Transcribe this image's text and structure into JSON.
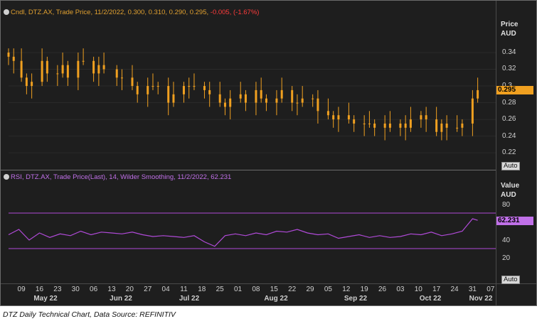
{
  "header_price": {
    "prefix": "Cndl, DTZ.AX, Trade Price, 11/2/2022, 0.300, 0.310, 0.290, 0.295, ",
    "change": "-0.005, (-1.67%)"
  },
  "header_rsi": "RSI, DTZ.AX, Trade Price(Last), 14, Wilder Smoothing, 11/2/2022, 62.231",
  "price_axis": {
    "title1": "Price",
    "title2": "AUD",
    "ticks": [
      "0.34",
      "0.32",
      "0.3",
      "0.28",
      "0.26",
      "0.24",
      "0.22"
    ],
    "last_tag": "0.295",
    "auto": "Auto"
  },
  "rsi_axis": {
    "title1": "Value",
    "title2": "AUD",
    "ticks": [
      "80",
      "60",
      "40",
      "20"
    ],
    "last_tag": "62.231",
    "auto": "Auto"
  },
  "x_ticks": [
    "09",
    "16",
    "23",
    "30",
    "06",
    "13",
    "20",
    "27",
    "04",
    "11",
    "18",
    "25",
    "01",
    "08",
    "15",
    "22",
    "29",
    "05",
    "12",
    "19",
    "26",
    "03",
    "10",
    "17",
    "24",
    "31",
    "07"
  ],
  "months": [
    "May 22",
    "Jun 22",
    "Jul 22",
    "Aug 22",
    "Sep 22",
    "Oct 22",
    "Nov 22"
  ],
  "caption": "DTZ Daily Technical Chart, Data Source: REFINITIV",
  "colors": {
    "candle": "#f0a020",
    "rsi": "#b04ad8",
    "background": "#1e1e1e",
    "change": "#ff3b3b"
  },
  "chart_data": [
    {
      "type": "candlestick",
      "title": "Cndl, DTZ.AX, Trade Price",
      "ylabel": "Price AUD",
      "ylim": [
        0.207,
        0.36
      ],
      "x_range": [
        "2022-05-04",
        "2022-11-09"
      ],
      "last_value": 0.295,
      "series": [
        {
          "name": "Close",
          "x": [
            "2022-05-04",
            "2022-05-06",
            "2022-05-09",
            "2022-05-11",
            "2022-05-13",
            "2022-05-17",
            "2022-05-19",
            "2022-05-23",
            "2022-05-25",
            "2022-05-27",
            "2022-05-31",
            "2022-06-02",
            "2022-06-06",
            "2022-06-08",
            "2022-06-10",
            "2022-06-15",
            "2022-06-17",
            "2022-06-21",
            "2022-06-23",
            "2022-06-27",
            "2022-06-29",
            "2022-07-01",
            "2022-07-05",
            "2022-07-07",
            "2022-07-11",
            "2022-07-13",
            "2022-07-15",
            "2022-07-19",
            "2022-07-21",
            "2022-07-25",
            "2022-07-27",
            "2022-07-29",
            "2022-08-02",
            "2022-08-04",
            "2022-08-08",
            "2022-08-10",
            "2022-08-12",
            "2022-08-16",
            "2022-08-18",
            "2022-08-22",
            "2022-08-24",
            "2022-08-26",
            "2022-08-30",
            "2022-09-01",
            "2022-09-05",
            "2022-09-07",
            "2022-09-09",
            "2022-09-13",
            "2022-09-15",
            "2022-09-19",
            "2022-09-21",
            "2022-09-23",
            "2022-09-27",
            "2022-09-29",
            "2022-10-03",
            "2022-10-05",
            "2022-10-07",
            "2022-10-11",
            "2022-10-13",
            "2022-10-17",
            "2022-10-19",
            "2022-10-21",
            "2022-10-25",
            "2022-10-27",
            "2022-10-31",
            "2022-11-02"
          ],
          "values": [
            0.335,
            0.33,
            0.31,
            0.3,
            0.305,
            0.33,
            0.315,
            0.315,
            0.325,
            0.31,
            0.33,
            0.33,
            0.315,
            0.325,
            0.32,
            0.31,
            0.31,
            0.3,
            0.29,
            0.3,
            0.3,
            0.3,
            0.28,
            0.29,
            0.3,
            0.3,
            0.3,
            0.295,
            0.29,
            0.28,
            0.275,
            0.285,
            0.29,
            0.28,
            0.295,
            0.285,
            0.28,
            0.285,
            0.295,
            0.28,
            0.28,
            0.285,
            0.285,
            0.27,
            0.265,
            0.26,
            0.265,
            0.26,
            0.255,
            0.255,
            0.255,
            0.25,
            0.255,
            0.25,
            0.255,
            0.25,
            0.26,
            0.265,
            0.26,
            0.245,
            0.255,
            0.25,
            0.25,
            0.255,
            0.285,
            0.295
          ]
        }
      ]
    },
    {
      "type": "line",
      "title": "RSI, DTZ.AX, Trade Price(Last), 14, Wilder Smoothing",
      "ylabel": "Value AUD",
      "ylim": [
        0,
        100
      ],
      "x_range": [
        "2022-05-04",
        "2022-11-09"
      ],
      "reference_lines": [
        70,
        30
      ],
      "series": [
        {
          "name": "RSI",
          "x": [
            "2022-05-04",
            "2022-05-08",
            "2022-05-12",
            "2022-05-16",
            "2022-05-20",
            "2022-05-24",
            "2022-05-28",
            "2022-06-01",
            "2022-06-05",
            "2022-06-09",
            "2022-06-13",
            "2022-06-17",
            "2022-06-21",
            "2022-06-25",
            "2022-06-29",
            "2022-07-03",
            "2022-07-07",
            "2022-07-11",
            "2022-07-15",
            "2022-07-19",
            "2022-07-23",
            "2022-07-27",
            "2022-07-31",
            "2022-08-04",
            "2022-08-08",
            "2022-08-12",
            "2022-08-16",
            "2022-08-20",
            "2022-08-24",
            "2022-08-28",
            "2022-09-01",
            "2022-09-05",
            "2022-09-09",
            "2022-09-13",
            "2022-09-17",
            "2022-09-21",
            "2022-09-25",
            "2022-09-29",
            "2022-10-03",
            "2022-10-07",
            "2022-10-11",
            "2022-10-15",
            "2022-10-19",
            "2022-10-23",
            "2022-10-27",
            "2022-10-31",
            "2022-11-02"
          ],
          "values": [
            46,
            52,
            40,
            48,
            43,
            47,
            45,
            50,
            46,
            49,
            48,
            47,
            49,
            46,
            44,
            45,
            44,
            43,
            45,
            38,
            33,
            45,
            47,
            45,
            48,
            46,
            50,
            49,
            52,
            48,
            46,
            47,
            42,
            44,
            46,
            43,
            45,
            43,
            44,
            47,
            46,
            49,
            45,
            47,
            50,
            64,
            62.231
          ]
        }
      ]
    }
  ]
}
